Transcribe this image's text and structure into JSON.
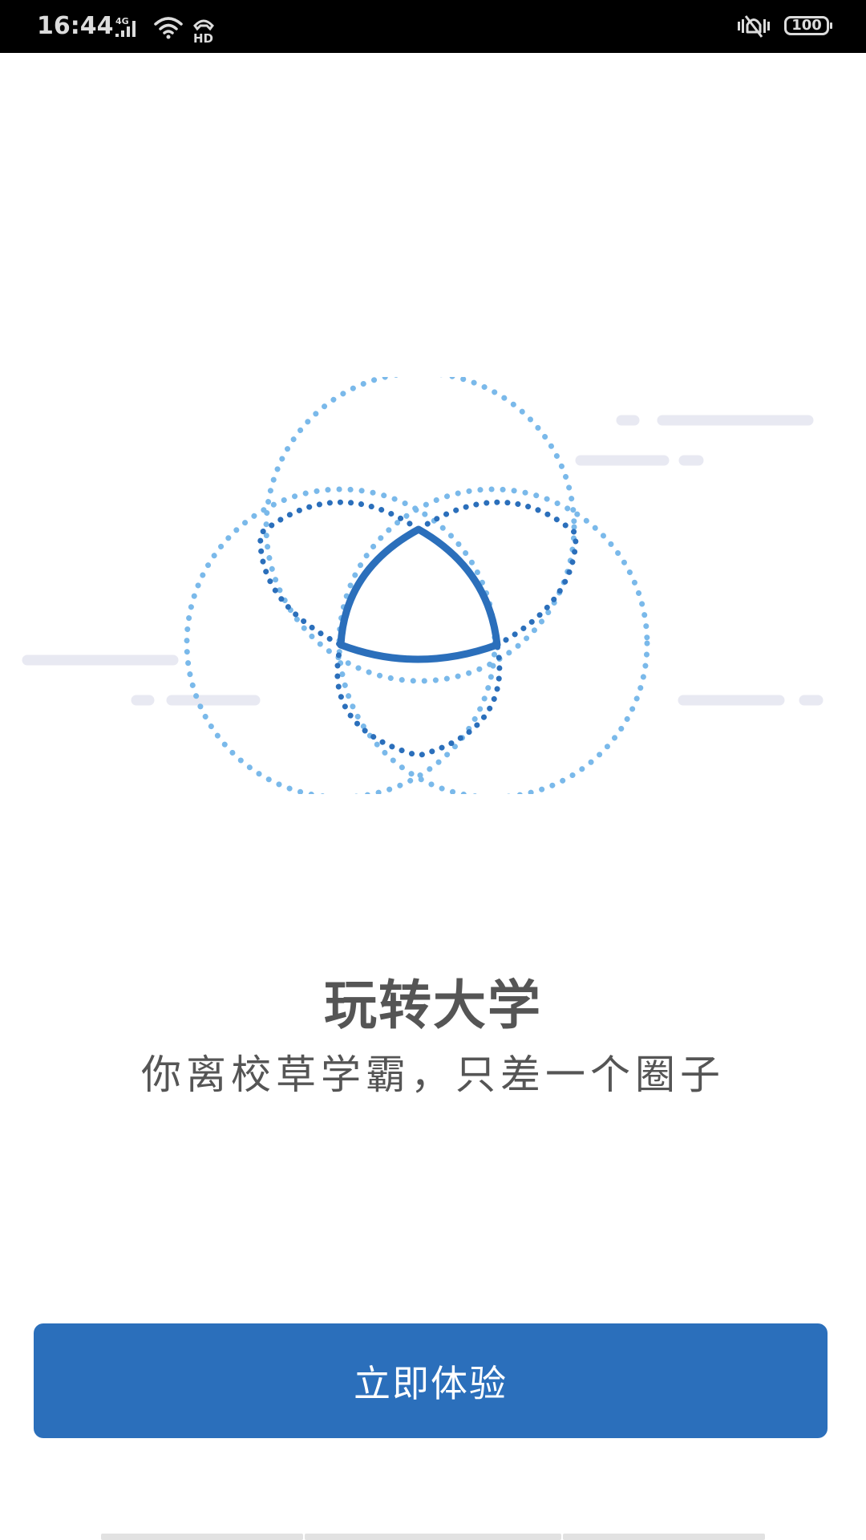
{
  "status_bar": {
    "time": "16:44",
    "network": "4G",
    "battery": "100"
  },
  "intro": {
    "headline": "玩转大学",
    "subline": "你离校草学霸，只差一个圈子"
  },
  "cta": {
    "label": "立即体验"
  },
  "colors": {
    "accent": "#2b6fbb",
    "accent_light": "#7ab9ea",
    "accent_dark": "#2b6fbb",
    "decor_line": "#e8e9f2",
    "text": "#555555"
  },
  "icons": [
    "signal-icon",
    "wifi-icon",
    "hd-call-icon",
    "vibrate-icon",
    "battery-icon"
  ]
}
